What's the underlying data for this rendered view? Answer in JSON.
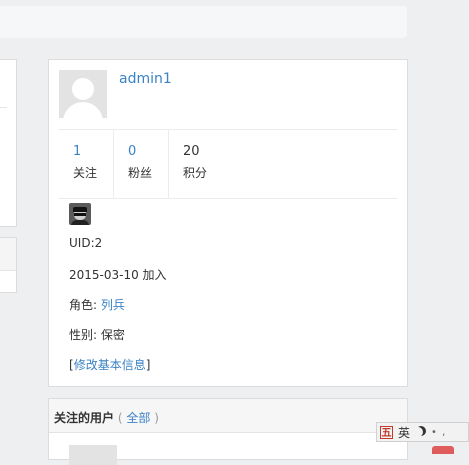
{
  "profile": {
    "username": "admin1",
    "stats": [
      {
        "value": "1",
        "label": "关注"
      },
      {
        "value": "0",
        "label": "粉丝"
      },
      {
        "value": "20",
        "label": "积分"
      }
    ],
    "uid": "UID:2",
    "joined": "2015-03-10 加入",
    "role_label": "角色:",
    "role_value": "列兵",
    "gender": "性别: 保密",
    "edit_open": "[",
    "edit_link": "修改基本信息",
    "edit_close": "]"
  },
  "following": {
    "title": "关注的用户",
    "open_paren": "(",
    "all_link": "全部",
    "close_paren": ")"
  },
  "ime": {
    "logo": "五",
    "lang": "英",
    "icons": [
      "moon-icon",
      "more-dots-icon"
    ],
    "dots": "• ,"
  },
  "colors": {
    "link": "#3a82c5",
    "background": "#eeeff1",
    "accent_red": "#e05c5c"
  }
}
